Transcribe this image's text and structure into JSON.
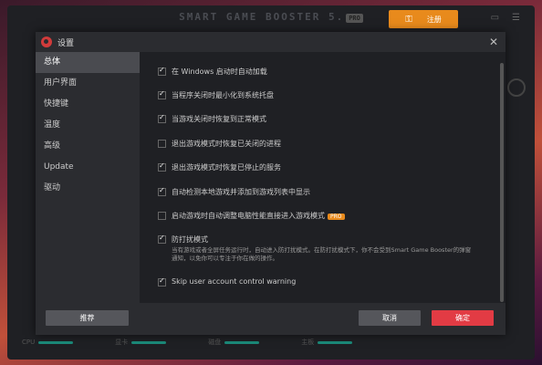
{
  "app": {
    "title": "SMART GAME BOOSTER 5.",
    "title_badge": "PRO",
    "register_label": "注册",
    "footer": [
      "CPU",
      "显卡",
      "磁盘",
      "主板"
    ]
  },
  "dialog": {
    "title": "设置",
    "sidebar": [
      {
        "label": "总体",
        "active": true
      },
      {
        "label": "用户界面",
        "active": false
      },
      {
        "label": "快捷键",
        "active": false
      },
      {
        "label": "温度",
        "active": false
      },
      {
        "label": "高级",
        "active": false
      },
      {
        "label": "Update",
        "active": false
      },
      {
        "label": "驱动",
        "active": false
      }
    ],
    "options": [
      {
        "label": "在 Windows 启动时自动加载",
        "checked": true
      },
      {
        "label": "当程序关闭时最小化到系统托盘",
        "checked": true
      },
      {
        "label": "当游戏关闭时恢复到正常模式",
        "checked": true
      },
      {
        "label": "退出游戏模式时恢复已关闭的进程",
        "checked": false
      },
      {
        "label": "退出游戏模式时恢复已停止的服务",
        "checked": true
      },
      {
        "label": "自动检测本地游戏并添加到游戏列表中显示",
        "checked": true
      },
      {
        "label": "启动游戏时自动调整电脑性能直接进入游戏模式",
        "checked": false,
        "badge": "PRO"
      },
      {
        "label": "防打扰模式",
        "checked": true,
        "description": "当有游戏或者全屏任务运行时，自动进入防打扰模式。在防打扰模式下，你不会受到Smart Game Booster的弹窗通知，以免你可以专注于你在做的操作。"
      },
      {
        "label": "Skip user account control warning",
        "checked": true
      }
    ],
    "buttons": {
      "recommend": "推荐",
      "cancel": "取消",
      "ok": "确定"
    }
  }
}
